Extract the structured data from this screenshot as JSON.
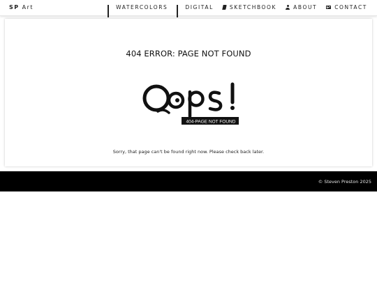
{
  "navbar": {
    "brand_bold": "SP",
    "brand_rest": "Art",
    "items": [
      {
        "label": "WATERCOLORS",
        "icon": "grid-icon"
      },
      {
        "label": "DIGITAL",
        "icon": "grid-icon"
      },
      {
        "label": "SKETCHBOOK",
        "icon": "book-icon"
      },
      {
        "label": "ABOUT",
        "icon": "user-icon"
      },
      {
        "label": "CONTACT",
        "icon": "envelope-icon"
      }
    ]
  },
  "main": {
    "title": "404 ERROR: PAGE NOT FOUND",
    "oops_text": "Oops!",
    "oops_badge": "404-PAGE NOT FOUND",
    "message": "Sorry, that page can't be found right now. Please check back later."
  },
  "footer": {
    "copyright": "© Steven Preston 2025"
  }
}
